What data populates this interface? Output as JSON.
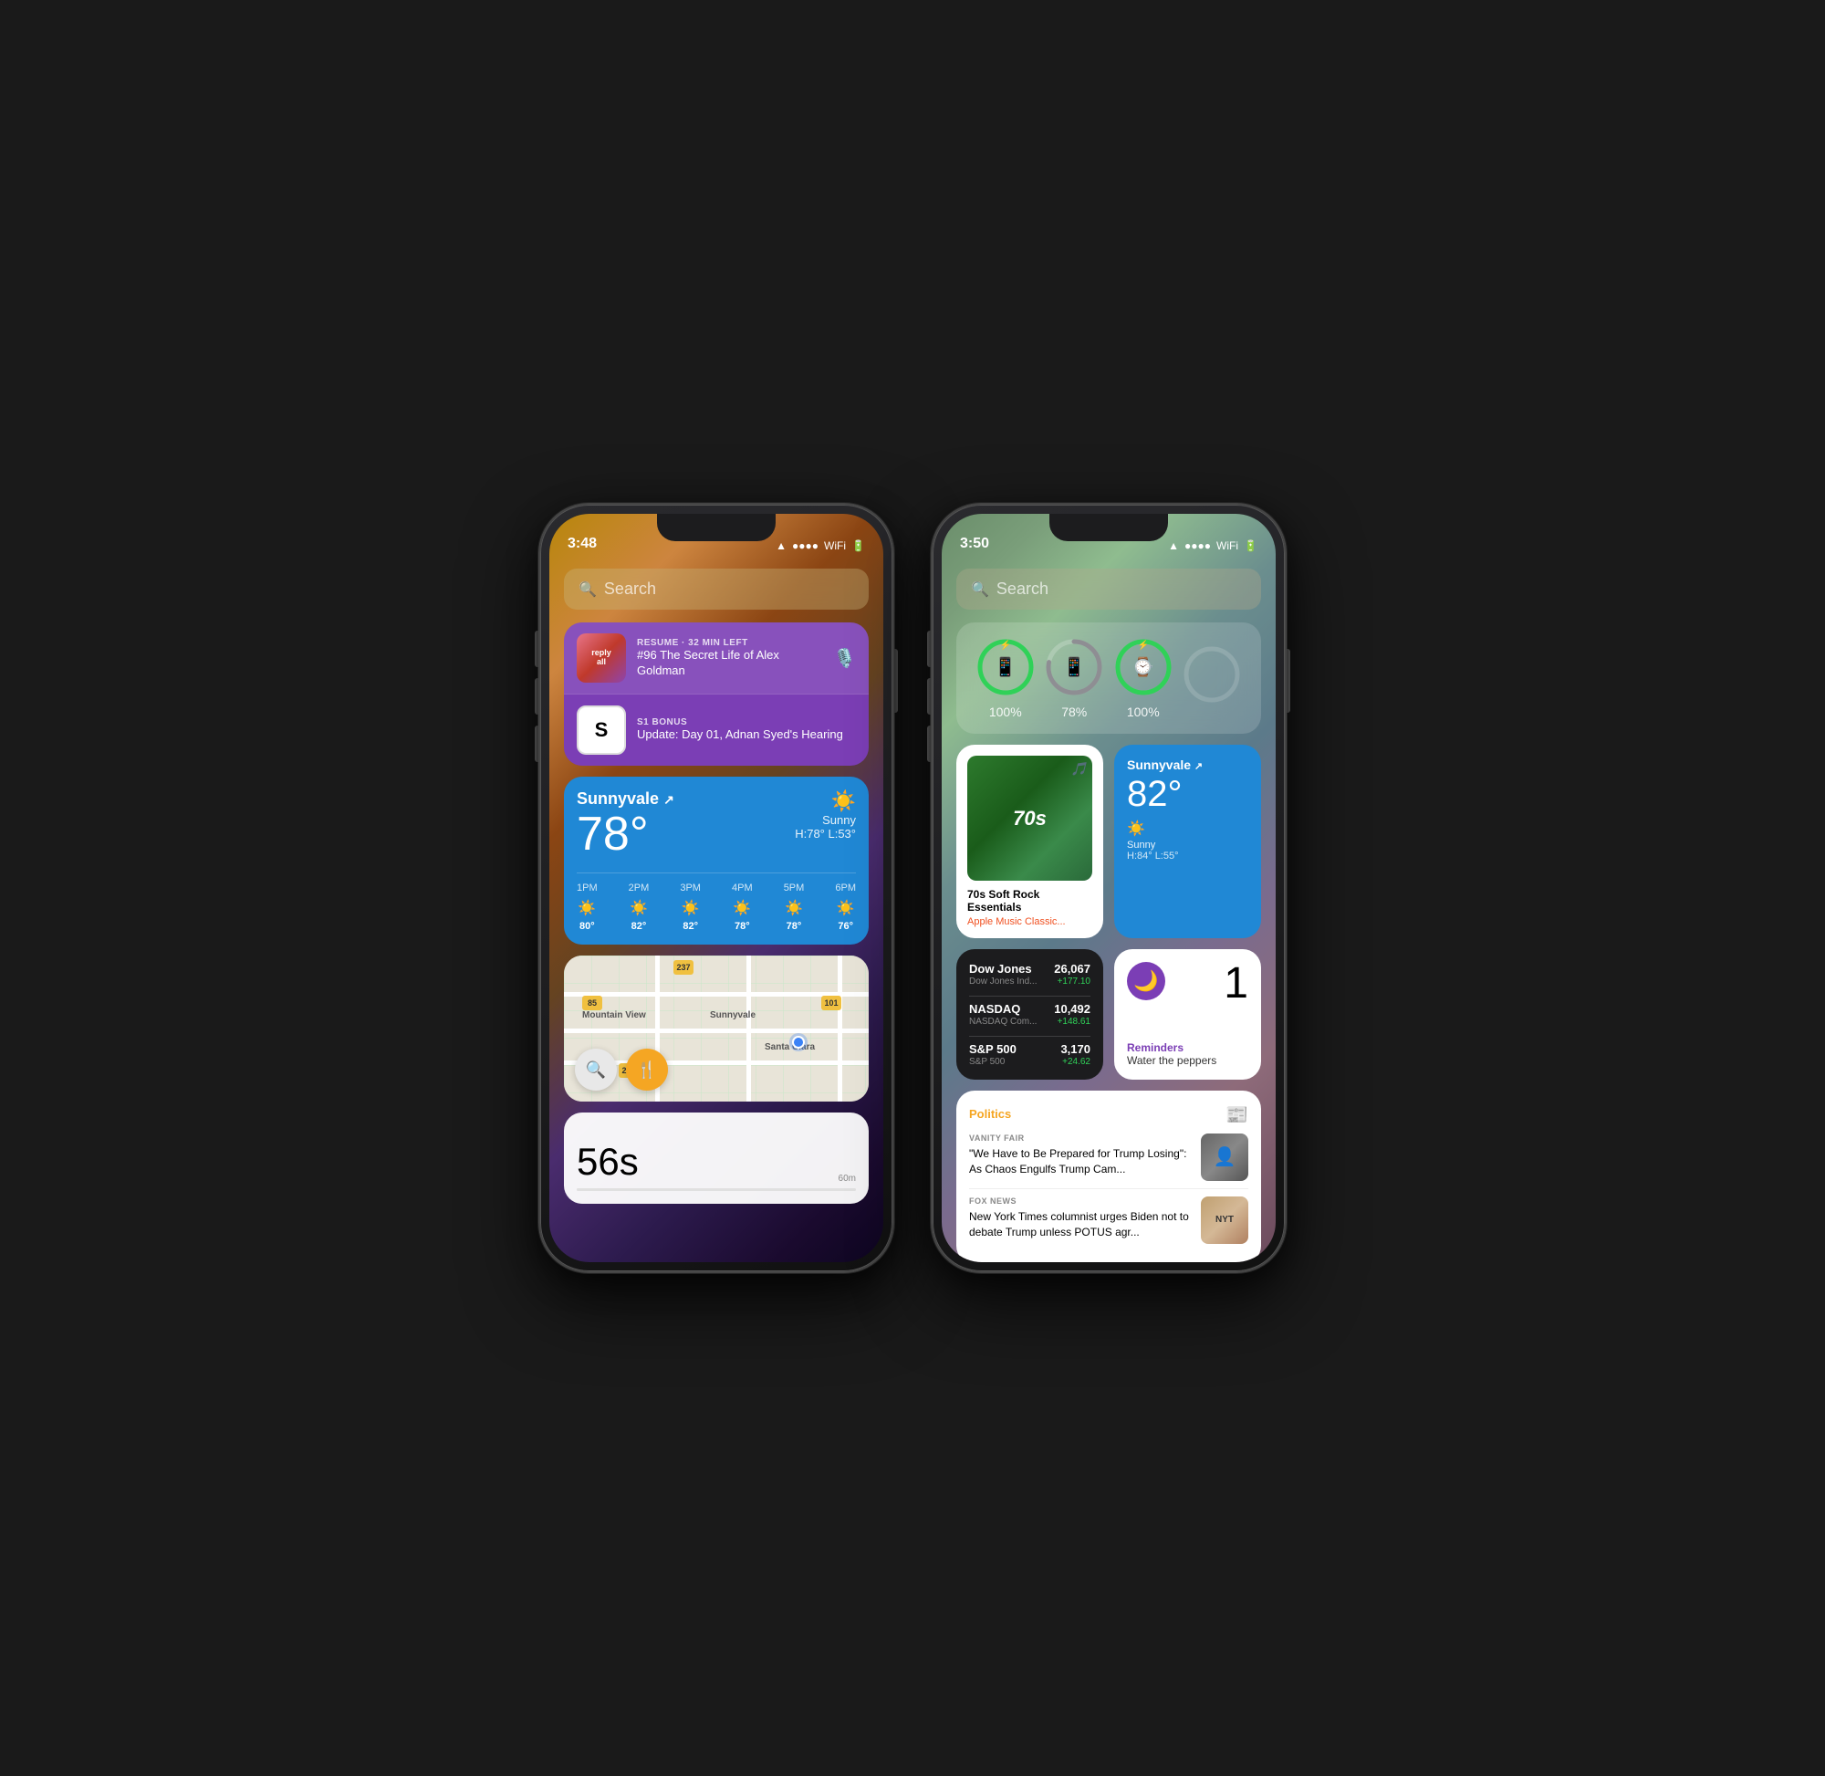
{
  "phones": {
    "left": {
      "time": "3:48",
      "search": "Search",
      "podcast_widget": {
        "item1": {
          "meta": "RESUME · 32 MIN LEFT",
          "title": "#96 The Secret Life of Alex Goldman"
        },
        "item2": {
          "meta": "S1 BONUS",
          "title": "Update: Day 01, Adnan Syed's Hearing"
        }
      },
      "weather": {
        "location": "Sunnyvale",
        "temp": "78°",
        "condition": "Sunny",
        "high_low": "H:78° L:53°",
        "hours": [
          {
            "time": "1PM",
            "temp": "80°"
          },
          {
            "time": "2PM",
            "temp": "82°"
          },
          {
            "time": "3PM",
            "temp": "82°"
          },
          {
            "time": "4PM",
            "temp": "78°"
          },
          {
            "time": "5PM",
            "temp": "78°"
          },
          {
            "time": "6PM",
            "temp": "76°"
          }
        ]
      },
      "map": {
        "places": [
          "Mountain View",
          "Sunnyvale",
          "Santa Clara"
        ],
        "highways": [
          "85",
          "237",
          "101",
          "280"
        ]
      },
      "timer": {
        "value": "56s",
        "end_label": "60m"
      }
    },
    "right": {
      "time": "3:50",
      "search": "Search",
      "batteries": [
        {
          "icon": "📱",
          "pct": "100%",
          "level": 100,
          "color": "green"
        },
        {
          "icon": "📱",
          "pct": "78%",
          "level": 78,
          "color": "gray"
        },
        {
          "icon": "⌚",
          "pct": "100%",
          "level": 100,
          "color": "green"
        },
        {
          "icon": "",
          "pct": "",
          "level": 0,
          "color": "gray"
        }
      ],
      "music": {
        "album_text": "70s",
        "title": "70s Soft Rock Essentials",
        "subtitle": "Apple Music Classic..."
      },
      "weather_small": {
        "location": "Sunnyvale",
        "temp": "82°",
        "condition": "Sunny",
        "high_low": "H:84° L:55°"
      },
      "stocks": [
        {
          "name": "Dow Jones",
          "full": "Dow Jones Ind...",
          "price": "26,067",
          "change": "+177.10"
        },
        {
          "name": "NASDAQ",
          "full": "NASDAQ Com...",
          "price": "10,492",
          "change": "+148.61"
        },
        {
          "name": "S&P 500",
          "full": "S&P 500",
          "price": "3,170",
          "change": "+24.62"
        }
      ],
      "reminders": {
        "count": "1",
        "label": "Reminders",
        "task": "Water the peppers"
      },
      "news": {
        "category": "Politics",
        "items": [
          {
            "source": "VANITY FAIR",
            "headline": "\"We Have to Be Prepared for Trump Losing\": As Chaos Engulfs Trump Cam..."
          },
          {
            "source": "FOX NEWS",
            "headline": "New York Times columnist urges Biden not to debate Trump unless POTUS agr..."
          }
        ]
      }
    }
  }
}
